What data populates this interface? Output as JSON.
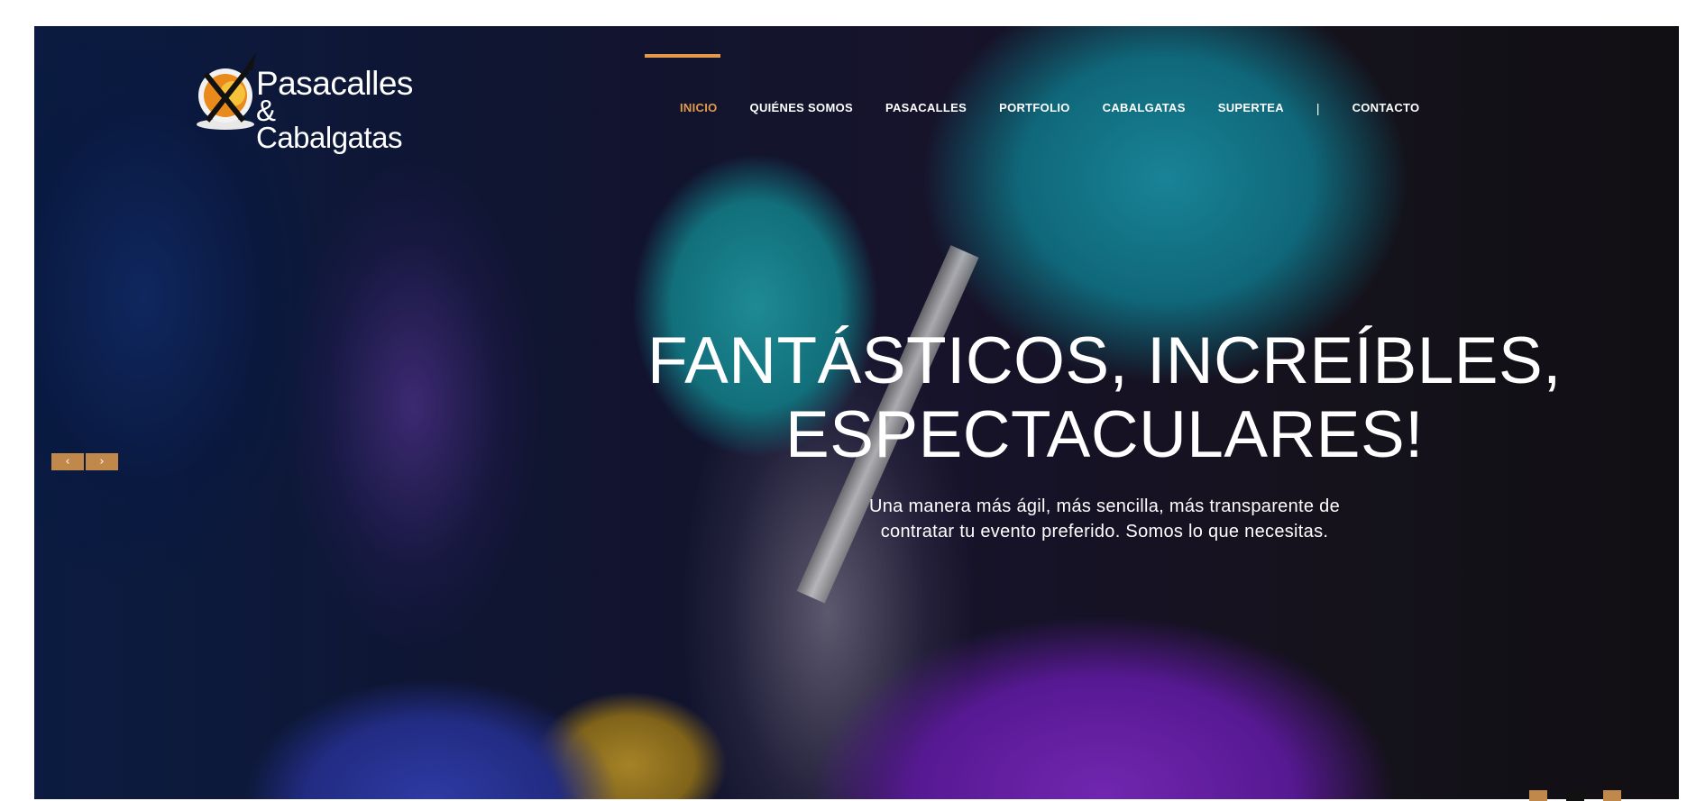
{
  "site": {
    "logo_line1": "Pasacalles",
    "logo_line2": "& Cabalgatas"
  },
  "nav": {
    "items": [
      {
        "label": "INICIO",
        "active": true
      },
      {
        "label": "QUIÉNES SOMOS"
      },
      {
        "label": "PASACALLES"
      },
      {
        "label": "PORTFOLIO"
      },
      {
        "label": "CABALGATAS"
      },
      {
        "label": "SUPERTEA"
      }
    ],
    "separator": "|",
    "contact_label": "CONTACTO"
  },
  "hero": {
    "headline_line1": "FANTÁSTICOS, INCREÍBLES,",
    "headline_line2": "ESPECTACULARES!",
    "subtitle_line1": "Una manera más ágil, más sencilla, más transparente de",
    "subtitle_line2": "contratar tu evento preferido. Somos lo que necesitas."
  },
  "slider": {
    "prev_icon": "chevron-left-icon",
    "prev_glyph": "‹",
    "next_icon": "chevron-right-icon",
    "next_glyph": "›",
    "dot_colors": [
      "#c0884a",
      "#111111",
      "#c0884a"
    ]
  },
  "colors": {
    "accent": "#e39a4a",
    "button": "#c0884a"
  }
}
